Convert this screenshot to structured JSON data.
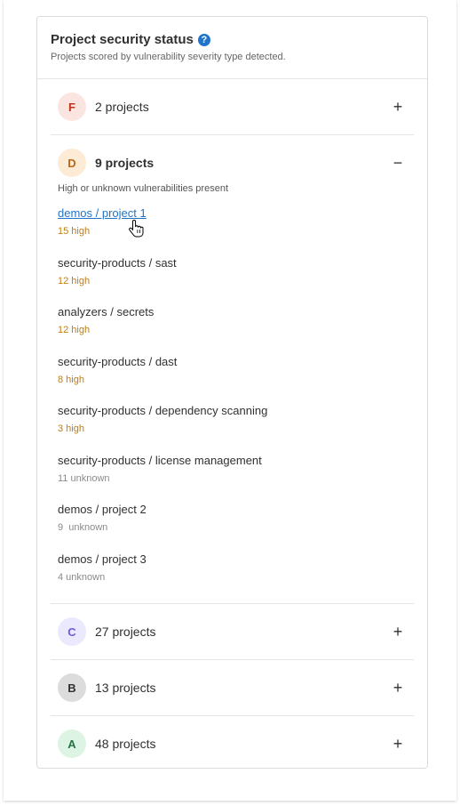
{
  "header": {
    "title": "Project security status",
    "help_icon": "?",
    "subtitle": "Projects scored by vulnerability severity type detected."
  },
  "colors": {
    "F": {
      "bg": "#fbe5e1",
      "fg": "#c0341d"
    },
    "D": {
      "bg": "#fdebd6",
      "fg": "#b7691e"
    },
    "C": {
      "bg": "#ebe9fd",
      "fg": "#6e5ad9"
    },
    "B": {
      "bg": "#dcdcdc",
      "fg": "#303030"
    },
    "A": {
      "bg": "#ddf3e4",
      "fg": "#217645"
    }
  },
  "groups": [
    {
      "grade": "F",
      "label": "2 projects",
      "toggle": "+",
      "expanded": false
    },
    {
      "grade": "D",
      "label": "9 projects",
      "toggle": "−",
      "expanded": true,
      "description": "High or unknown vulnerabilities present",
      "projects": [
        {
          "name": "demos / project 1",
          "count": "15 high",
          "kind": "high"
        },
        {
          "name": "security-products / sast",
          "count": "12 high",
          "kind": "high"
        },
        {
          "name": "analyzers / secrets",
          "count": "12 high",
          "kind": "high"
        },
        {
          "name": "security-products / dast",
          "count": "8 high",
          "kind": "high"
        },
        {
          "name": "security-products / dependency scanning",
          "count": "3 high",
          "kind": "high"
        },
        {
          "name": "security-products / license management",
          "count": "11 unknown",
          "kind": "unknown"
        },
        {
          "name": "demos / project 2",
          "count": "9  unknown",
          "kind": "unknown"
        },
        {
          "name": "demos / project 3",
          "count": "4 unknown",
          "kind": "unknown"
        }
      ]
    },
    {
      "grade": "C",
      "label": "27 projects",
      "toggle": "+",
      "expanded": false
    },
    {
      "grade": "B",
      "label": "13 projects",
      "toggle": "+",
      "expanded": false
    },
    {
      "grade": "A",
      "label": "48 projects",
      "toggle": "+",
      "expanded": false
    }
  ]
}
